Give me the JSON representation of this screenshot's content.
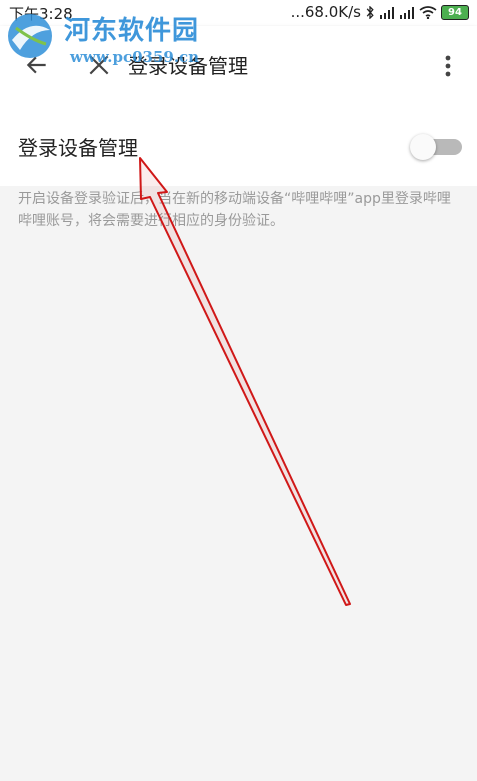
{
  "status_bar": {
    "time": "下午3:28",
    "speed": "...68.0K/s",
    "battery": "94"
  },
  "watermark": {
    "title": "河东软件园",
    "url": "www.pc0359.cn"
  },
  "app_bar": {
    "title": "登录设备管理",
    "back_icon": "arrow-left-icon",
    "close_icon": "close-icon",
    "more_icon": "more-vert-icon"
  },
  "setting": {
    "label": "登录设备管理",
    "enabled": false,
    "description": "开启设备登录验证后，当在新的移动端设备“哔哩哔哩”app里登录哔哩哔哩账号，将会需要进行相应的身份验证。"
  },
  "colors": {
    "annotation_arrow": "#d01818",
    "watermark": "#2f8fd8",
    "toggle_off_track": "#b9b9b9"
  }
}
